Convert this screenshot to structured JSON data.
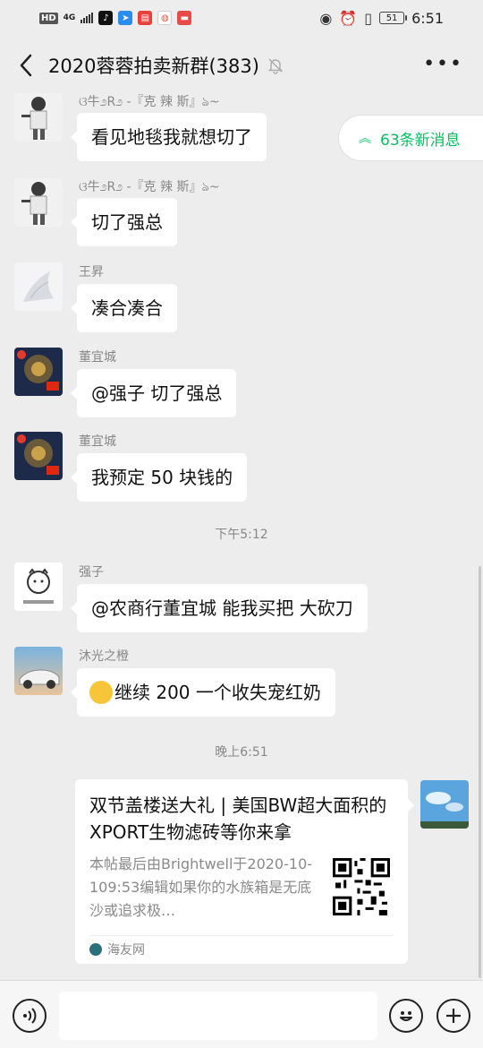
{
  "status_bar": {
    "hd": "HD",
    "signal": "4G",
    "time": "6:51",
    "battery": "51"
  },
  "header": {
    "title": "2020蓉蓉拍卖新群(383)"
  },
  "new_messages": {
    "label": "63条新消息"
  },
  "messages": [
    {
      "sender": "ଓ牛೨R೨ -『克 辣 斯』ঌ~",
      "text": "看见地毯我就想切了"
    },
    {
      "sender": "ଓ牛೨R೨ -『克 辣 斯』ঌ~",
      "text": "切了强总"
    },
    {
      "sender": "王昇",
      "text": "凑合凑合"
    },
    {
      "sender": "董宜城",
      "text": "@强子  切了强总"
    },
    {
      "sender": "董宜城",
      "text": "我预定 50 块钱的"
    },
    {
      "sender": "强子",
      "text": "@农商行董宜城   能我买把 大砍刀"
    },
    {
      "sender": "沐光之橙",
      "text": "继续 200 一个收失宠红奶"
    }
  ],
  "timestamps": [
    "下午5:12",
    "晚上6:51"
  ],
  "link_card": {
    "title": "双节盖楼送大礼 | 美国BW超大面积的XPORT生物滤砖等你来拿",
    "description": "本帖最后由Brightwell于2020-10-109:53编辑如果你的水族箱是无底沙或追求极…",
    "source": "海友网"
  },
  "icons": {
    "back": "chevron-left-icon",
    "mute": "bell-mute-icon",
    "more": "more-dots-icon",
    "voice": "voice-icon",
    "emoji": "emoji-icon",
    "add": "plus-icon"
  },
  "colors": {
    "background": "#ededed",
    "accent": "#07c160",
    "bubble": "#ffffff"
  }
}
